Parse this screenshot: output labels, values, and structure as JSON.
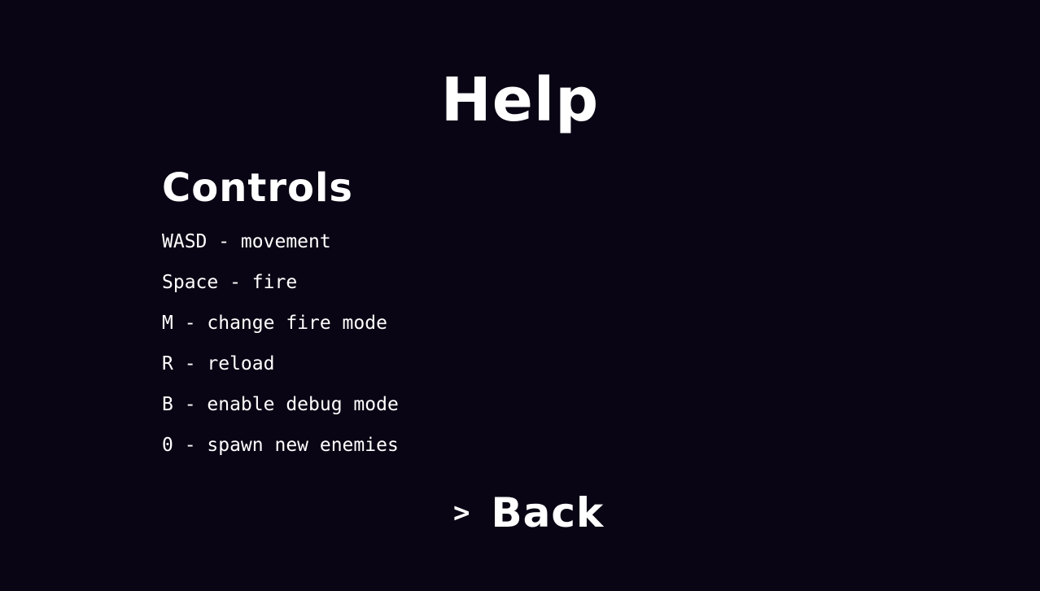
{
  "screen": {
    "title": "Help",
    "background_color": "#0a0514",
    "text_color": "#ffffff"
  },
  "controls": {
    "heading": "Controls",
    "lines": [
      "WASD - movement",
      "Space - fire",
      "M - change fire mode",
      "R - reload",
      "B - enable debug mode",
      "0 - spawn new enemies"
    ]
  },
  "menu": {
    "cursor": ">",
    "back_label": "Back"
  }
}
